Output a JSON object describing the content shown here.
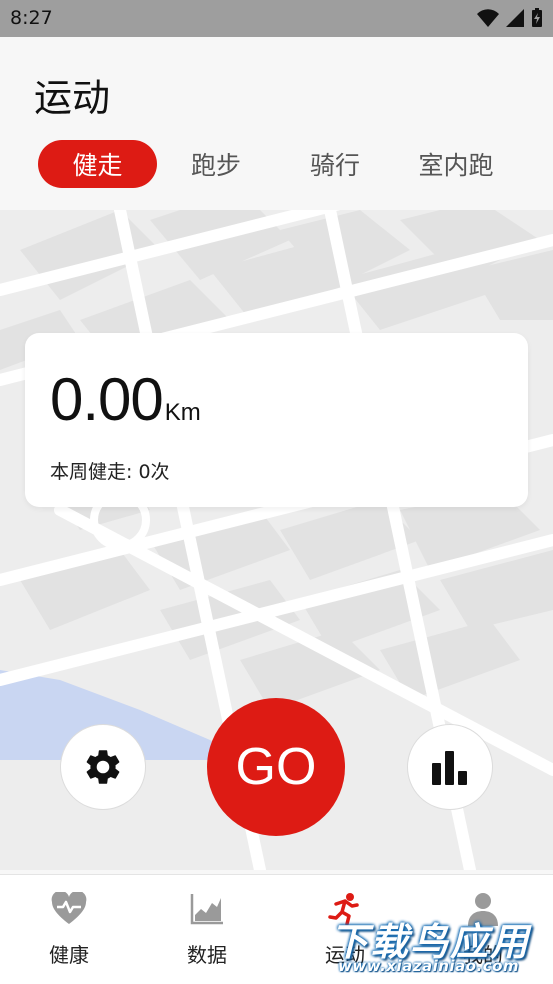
{
  "status_bar": {
    "time": "8:27"
  },
  "header": {
    "title": "运动",
    "tabs": [
      {
        "label": "健走",
        "active": true
      },
      {
        "label": "跑步",
        "active": false
      },
      {
        "label": "骑行",
        "active": false
      },
      {
        "label": "室内跑",
        "active": false
      }
    ]
  },
  "stats": {
    "distance_value": "0.00",
    "distance_unit": "Km",
    "weekly_text": "本周健走: 0次"
  },
  "controls": {
    "go_label": "GO",
    "settings_icon": "gear-icon",
    "stats_icon": "bar-chart-icon"
  },
  "bottom_nav": {
    "items": [
      {
        "label": "健康",
        "icon": "heart-pulse-icon",
        "active": false
      },
      {
        "label": "数据",
        "icon": "area-chart-icon",
        "active": false
      },
      {
        "label": "运动",
        "icon": "runner-icon",
        "active": true
      },
      {
        "label": "我的",
        "icon": "person-icon",
        "active": false
      }
    ]
  },
  "watermark": {
    "title": "下载鸟应用",
    "url": "www.xiazainiao.com"
  },
  "colors": {
    "accent": "#dd1b14",
    "status_bar": "#9e9e9e",
    "map_water": "#c9d6f2"
  }
}
